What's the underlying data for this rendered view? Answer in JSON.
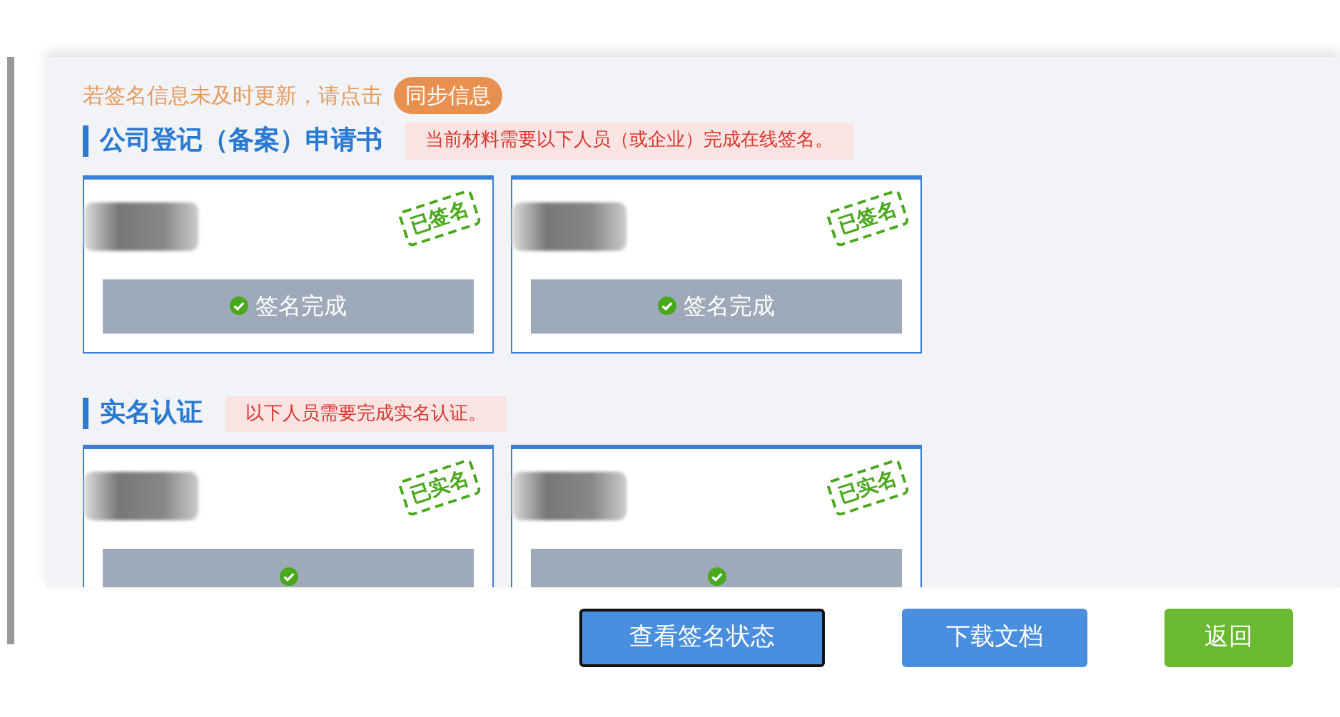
{
  "sync_notice": {
    "text": "若签名信息未及时更新，请点击",
    "button": "同步信息"
  },
  "sections": [
    {
      "title": "公司登记（备案）申请书",
      "notice": "当前材料需要以下人员（或企业）完成在线签名。",
      "cards": [
        {
          "stamp": "已签名",
          "status": "签名完成",
          "complete": true
        },
        {
          "stamp": "已签名",
          "status": "签名完成",
          "complete": true
        }
      ]
    },
    {
      "title": "实名认证",
      "notice": "以下人员需要完成实名认证。",
      "cards": [
        {
          "stamp": "已实名",
          "complete": true
        },
        {
          "stamp": "已实名",
          "complete": true
        }
      ]
    }
  ],
  "buttons": [
    {
      "label": "查看签名状态",
      "kind": "primary",
      "focused": true
    },
    {
      "label": "下载文档",
      "kind": "primary",
      "focused": false
    },
    {
      "label": "返回",
      "kind": "success",
      "focused": false
    }
  ]
}
